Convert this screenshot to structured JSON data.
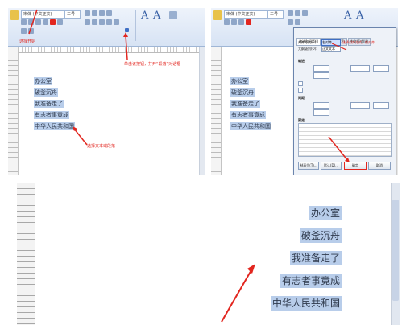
{
  "panel1": {
    "ribbon": {
      "font_name": "宋体 (中文正文)",
      "font_size": "三号",
      "style_label": "A"
    },
    "caption_top": "选择开始",
    "caption_right": "单击该按钮，打开“段落”对话框",
    "caption_bottom": "选择文本或段落",
    "lines": [
      "办公室",
      "破釜沉舟",
      "我准备走了",
      "有志者事竟成",
      "中华人民共和国"
    ]
  },
  "panel2": {
    "lines": [
      "办公室",
      "破釜沉舟",
      "我准备走了",
      "有志者事竟成",
      "中华人民共和国"
    ],
    "dialog": {
      "tabs": [
        "缩进和间距(I)",
        "换行和分页(P)",
        "中文版式(H)"
      ],
      "align_label": "对齐方式(G):",
      "align_value": "右对齐",
      "level_label": "大纲级别(O):",
      "level_value": "正文文本",
      "indent_label": "缩进",
      "spacing_label": "间距",
      "preview_label": "预览",
      "annotation": "选择对齐方式，在对齐",
      "buttons": [
        "制表位(T)...",
        "默认(D)...",
        "确定",
        "取消"
      ]
    }
  },
  "panel3": {
    "lines": [
      "办公室",
      "破釜沉舟",
      "我准备走了",
      "有志者事竟成",
      "中华人民共和国"
    ]
  },
  "colors": {
    "highlight": "#b8cdea",
    "annotation_red": "#e2261f",
    "ribbon": "#d7e3f4"
  }
}
